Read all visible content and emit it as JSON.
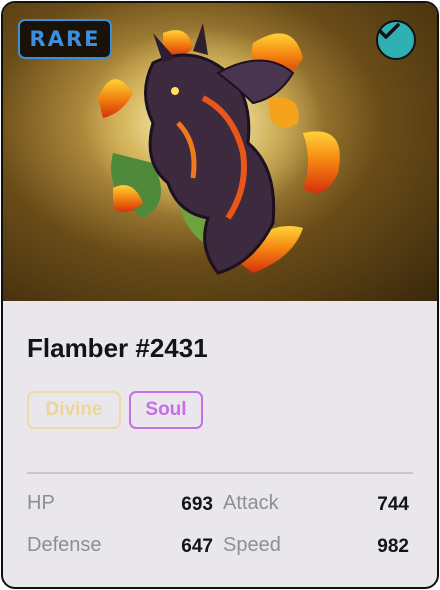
{
  "badge": {
    "rarity": "RARE",
    "verified_icon": "checkmark-icon"
  },
  "creature": {
    "name": "Flamber #2431",
    "art_icon": "fire-dragon-artwork"
  },
  "tags": [
    {
      "label": "Divine",
      "color": "#ecd59c"
    },
    {
      "label": "Soul",
      "color": "#c56ee8"
    }
  ],
  "stats": {
    "hp": {
      "label": "HP",
      "value": "693"
    },
    "attack": {
      "label": "Attack",
      "value": "744"
    },
    "defense": {
      "label": "Defense",
      "value": "647"
    },
    "speed": {
      "label": "Speed",
      "value": "982"
    }
  },
  "colors": {
    "rarity": "#3b8fe0",
    "verified": "#2fb0b3",
    "card_bg": "#e9e7ec"
  }
}
